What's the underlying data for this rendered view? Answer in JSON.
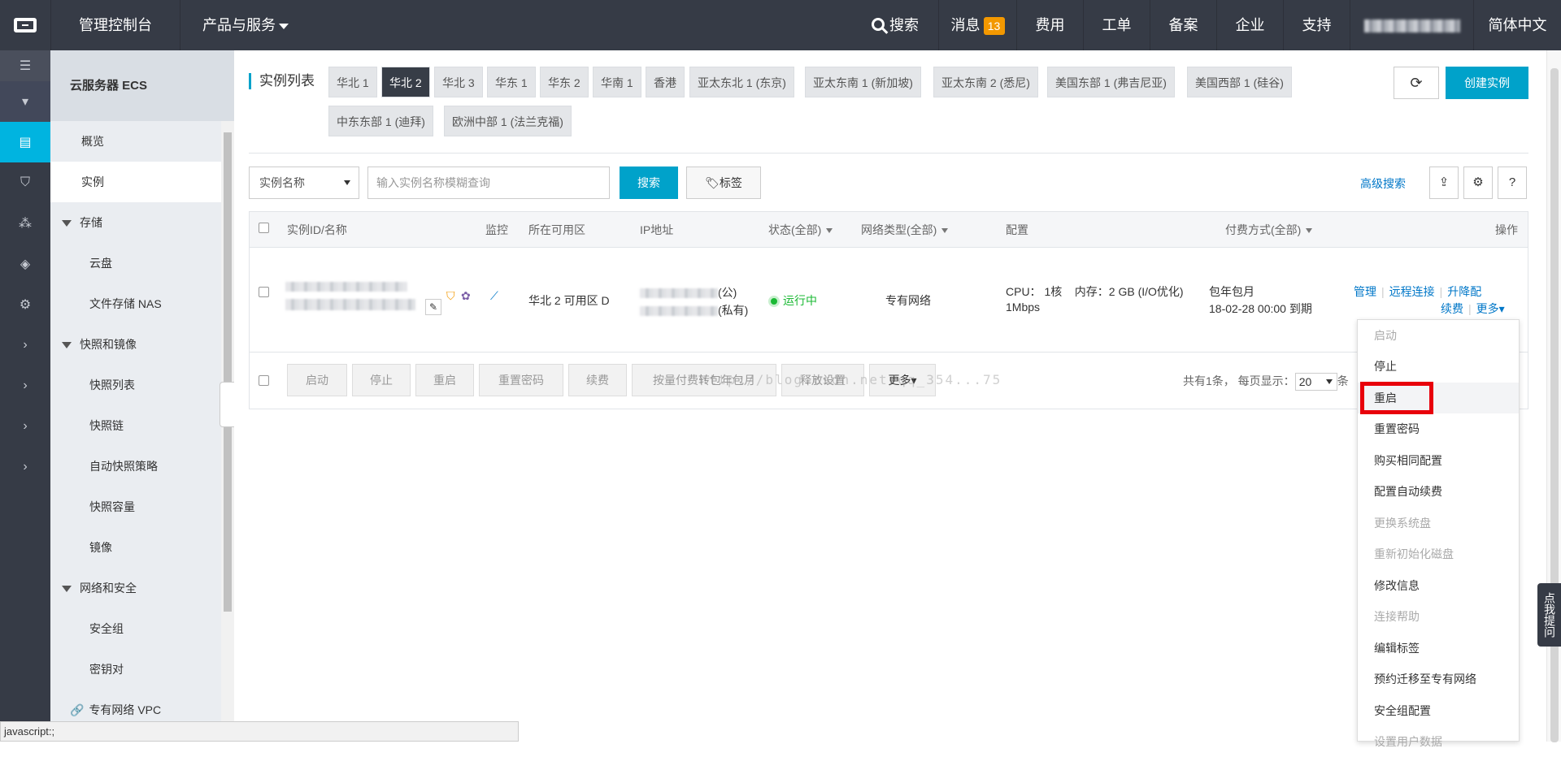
{
  "topbar": {
    "console": "管理控制台",
    "products": "产品与服务",
    "search": "搜索",
    "messages": "消息",
    "messages_count": "13",
    "nav": [
      "费用",
      "工单",
      "备案",
      "企业",
      "支持"
    ],
    "language": "简体中文"
  },
  "sidebar": {
    "title": "云服务器 ECS",
    "overview": "概览",
    "instances": "实例",
    "storage": "存储",
    "disk": "云盘",
    "nas": "文件存储 NAS",
    "snapshot_group": "快照和镜像",
    "snapshot_list": "快照列表",
    "snapshot_chain": "快照链",
    "auto_snapshot": "自动快照策略",
    "snapshot_capacity": "快照容量",
    "image": "镜像",
    "network_group": "网络和安全",
    "security_group": "安全组",
    "keypair": "密钥对",
    "vpc": "专有网络 VPC"
  },
  "main": {
    "title": "实例列表",
    "regions_row1": [
      "华北 1",
      "华北 2",
      "华北 3",
      "华东 1",
      "华东 2",
      "华南 1",
      "香港",
      "亚太东北 1 (东京)",
      "亚太东南 1 (新加坡)",
      "亚太东南 2 (悉尼)",
      "美国东部 1 (弗吉尼亚)",
      "美国西部 1 (硅谷)"
    ],
    "regions_row2": [
      "中东东部 1 (迪拜)",
      "欧洲中部 1 (法兰克福)"
    ],
    "create_btn": "创建实例",
    "filter_select": "实例名称",
    "search_placeholder": "输入实例名称模糊查询",
    "search_btn": "搜索",
    "tag_btn": "标签",
    "advanced_search": "高级搜索"
  },
  "table": {
    "headers": {
      "id": "实例ID/名称",
      "monitor": "监控",
      "zone": "所在可用区",
      "ip": "IP地址",
      "status": "状态(全部)",
      "network": "网络类型(全部)",
      "config": "配置",
      "billing": "付费方式(全部)",
      "ops": "操作"
    },
    "row": {
      "zone": "华北 2 可用区 D",
      "ip_public_suffix": "(公)",
      "ip_private_suffix": "(私有)",
      "status": "运行中",
      "network": "专有网络",
      "config_line1": "CPU： 1核    内存：2 GB (I/O优化)",
      "config_line2": "1Mbps",
      "billing_line1": "包年包月",
      "billing_line2": "18-02-28 00:00 到期",
      "op_manage": "管理",
      "op_remote": "远程连接",
      "op_upgrade": "升降配",
      "op_renew": "续费",
      "op_more": "更多"
    },
    "footer_buttons": [
      "启动",
      "停止",
      "重启",
      "重置密码",
      "续费",
      "按量付费转包年包月",
      "释放设置",
      "更多"
    ],
    "pager_text_1": "共有1条， 每页显示：",
    "pager_size": "20",
    "pager_text_2": "条"
  },
  "dropdown": {
    "items": [
      {
        "label": "启动",
        "disabled": true
      },
      {
        "label": "停止",
        "disabled": false
      },
      {
        "label": "重启",
        "disabled": false
      },
      {
        "label": "重置密码",
        "disabled": false
      },
      {
        "label": "购买相同配置",
        "disabled": false
      },
      {
        "label": "配置自动续费",
        "disabled": false
      },
      {
        "label": "更换系统盘",
        "disabled": true
      },
      {
        "label": "重新初始化磁盘",
        "disabled": true
      },
      {
        "label": "修改信息",
        "disabled": false
      },
      {
        "label": "连接帮助",
        "disabled": true
      },
      {
        "label": "编辑标签",
        "disabled": false
      },
      {
        "label": "预约迁移至专有网络",
        "disabled": false
      },
      {
        "label": "安全组配置",
        "disabled": false
      },
      {
        "label": "设置用户数据",
        "disabled": true
      }
    ]
  },
  "feedback": "点我提问",
  "statusbar": "javascript:;",
  "watermark": "http://blog.csdn.net/qq_354...75",
  "colors": {
    "accent": "#00a2ca",
    "topbar": "#363b46",
    "highlight": "#e8000b",
    "badge": "#f39800",
    "running": "#1bb934"
  }
}
